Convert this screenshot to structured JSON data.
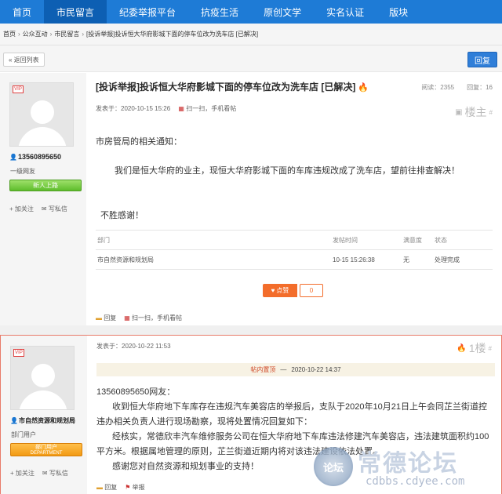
{
  "nav": {
    "items": [
      "首页",
      "市民留言",
      "纪委举报平台",
      "抗疫生活",
      "原创文学",
      "实名认证",
      "版块"
    ],
    "active_index": 1
  },
  "breadcrumb": [
    "首页",
    "公众互动",
    "市民留言",
    "[投诉举报]投诉恒大华府影城下面的停车位改为洗车店 [已解决]"
  ],
  "toolbar": {
    "back_label": "« 返回列表",
    "reply_label": "回复"
  },
  "post1": {
    "title": "[投诉举报]投诉恒大华府影城下面的停车位改为洗车店 [已解决]",
    "views_label": "阅读：2355",
    "replies_label": "回复：16",
    "posted": "发表于：2020-10-15 15:26",
    "qr_label": "扫一扫，手机看帖",
    "floor": "楼主",
    "floor_sup": "#",
    "user": {
      "vip": "VIP",
      "name": "13560895650",
      "level": "一级网友",
      "badge": "新人上路",
      "follow": "加关注",
      "message": "写私信"
    },
    "paragraphs": [
      "市房管局的相关通知：",
      "我们是恒大华府的业主，现恒大华府影城下面的车库违规改成了洗车店，望前往排查解决！",
      "不胜感谢！"
    ],
    "table": {
      "headers": [
        "部门",
        "发帖时间",
        "满意度",
        "状态"
      ],
      "rows": [
        [
          "市自然资源和规划局",
          "10-15 15:26:38",
          "无",
          "处理完成"
        ]
      ]
    },
    "like_label": "点赞",
    "like_count": "0",
    "actions": [
      "回复",
      "扫一扫，手机看帖"
    ]
  },
  "post2": {
    "posted": "发表于：2020-10-22 11:53",
    "floor": "1楼",
    "floor_sup": "#",
    "user": {
      "vip": "VIP",
      "name": "市自然资源和规划局",
      "level": "部门用户",
      "badge_line1": "部门用户",
      "badge_line2": "DEPARTMENT",
      "follow": "加关注",
      "message": "写私信"
    },
    "quote": {
      "dept": "帖内置顶",
      "sep": "—",
      "time": "2020-10-22 14:37"
    },
    "paragraphs": [
      "13560895650网友：",
      "收到恒大华府地下车库存在违规汽车美容店的举报后，支队于2020年10月21日上午会同芷兰街道控违办相关负责人进行现场勘察，现将处置情况回复如下：",
      "经核实，常德欣丰汽车维修服务公司在恒大华府地下车库违法修建汽车美容店，违法建筑面积约100平方米。根据属地管理的原则，芷兰街道近期内将对该违法建设依法处置。",
      "感谢您对自然资源和规划事业的支持！"
    ],
    "actions": [
      "回复",
      "举报"
    ]
  },
  "watermark": {
    "seal": "论坛",
    "text": "常德论坛",
    "url": "cdbbs.cdyee.com"
  },
  "colors": {
    "nav": "#1e7bd6",
    "accent": "#f36d2b",
    "highlight_border": "#e87b6a"
  }
}
